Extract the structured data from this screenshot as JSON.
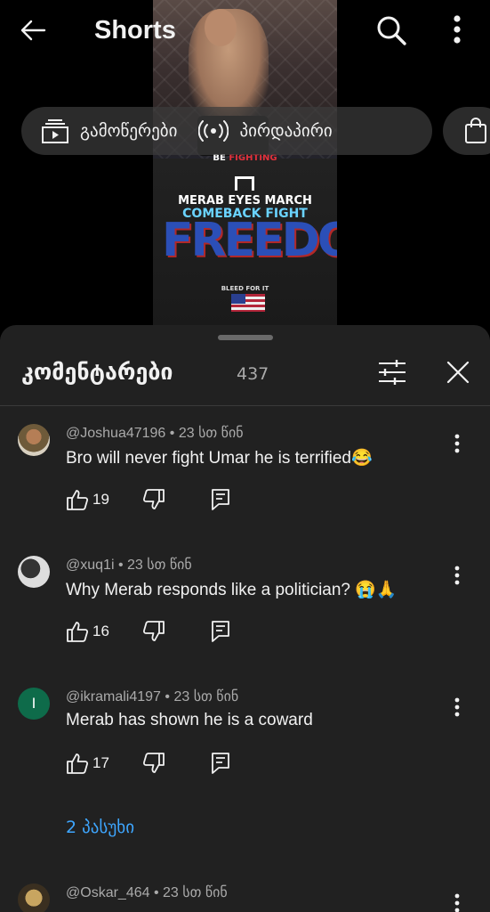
{
  "header": {
    "title": "Shorts"
  },
  "chips": {
    "chip1_label": "გამოწერები",
    "chip2_label": "პირდაპირი"
  },
  "video": {
    "overlay_line1_a": "BE ",
    "overlay_line1_b": "FIGHTING",
    "overlay_line2": "MERAB EYES MARCH",
    "overlay_line3": "COMEBACK FIGHT",
    "shirt_text": "FREEDOM",
    "shirt_small": "BLEED FOR IT"
  },
  "comments_sheet": {
    "title": "კომენტარები",
    "count": "437",
    "comments": [
      {
        "meta": "@Joshua47196 • 23 სთ წინ",
        "text": "Bro will never fight Umar he is terrified😂",
        "likes": "19"
      },
      {
        "meta": "@xuq1i • 23 სთ წინ",
        "text": "Why Merab responds like a politician? 😭🙏",
        "likes": "16"
      },
      {
        "meta": "@ikramali4197 • 23 სთ წინ",
        "avatar_letter": "I",
        "text": "Merab has shown he is a coward",
        "likes": "17",
        "replies_label": "2 პასუხი"
      },
      {
        "meta": "@Oskar_464 • 23 სთ წინ"
      }
    ]
  },
  "icons": {
    "back": "arrow-left-icon",
    "search": "search-icon",
    "more": "more-vertical-icon",
    "subscriptions": "subscriptions-icon",
    "live": "live-broadcast-icon",
    "shopping": "shopping-bag-icon",
    "filter": "sliders-icon",
    "close": "close-icon",
    "like": "thumbs-up-icon",
    "dislike": "thumbs-down-icon",
    "reply": "reply-comment-icon"
  },
  "colors": {
    "sheet_bg": "#212121",
    "link_blue": "#3ea6ff",
    "secondary_text": "#aaaaaa"
  }
}
